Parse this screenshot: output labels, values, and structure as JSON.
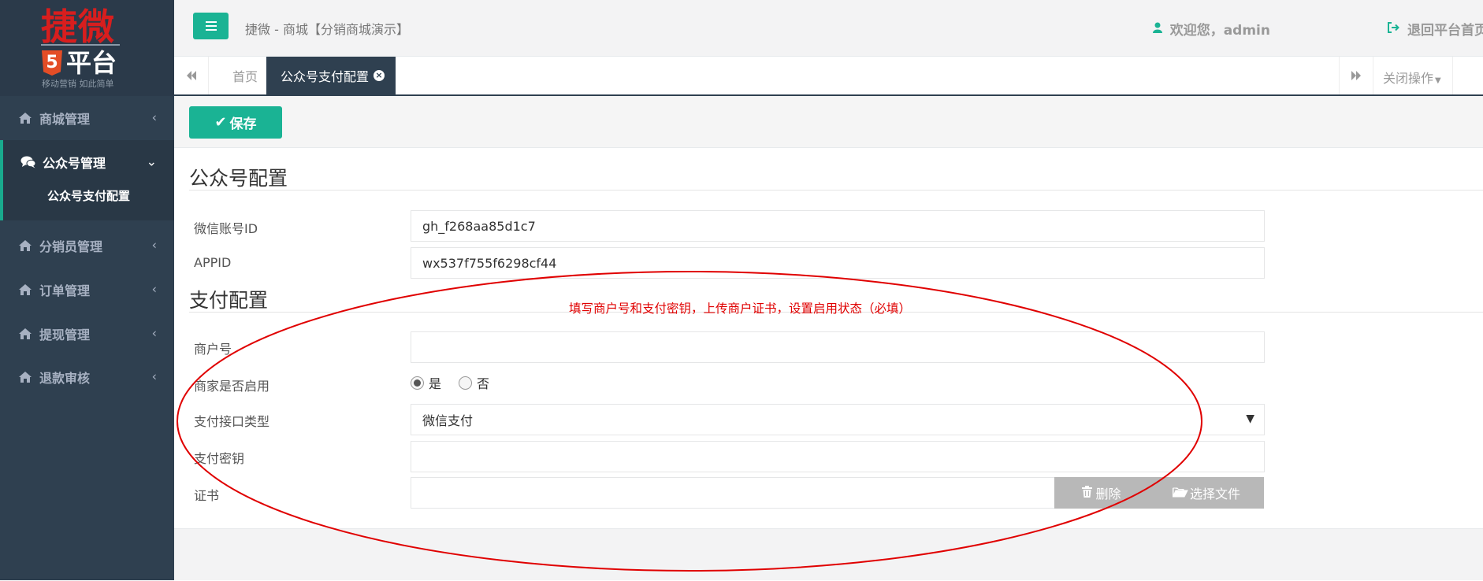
{
  "sidebar": {
    "logo": {
      "brand": "捷微",
      "five": "5",
      "platform": "平台",
      "slogan": "移动营销 如此简单"
    },
    "items": [
      {
        "label": "商城管理",
        "icon": "home-icon",
        "expanded": false
      },
      {
        "label": "公众号管理",
        "icon": "comments-icon",
        "expanded": true,
        "children": [
          {
            "label": "公众号支付配置"
          }
        ]
      },
      {
        "label": "分销员管理",
        "icon": "home-icon",
        "expanded": false
      },
      {
        "label": "订单管理",
        "icon": "home-icon",
        "expanded": false
      },
      {
        "label": "提现管理",
        "icon": "home-icon",
        "expanded": false
      },
      {
        "label": "退款审核",
        "icon": "home-icon",
        "expanded": false
      }
    ],
    "arrow_collapsed": "‹",
    "arrow_expanded": "⌄"
  },
  "header": {
    "title": "捷微 - 商城【分销商城演示】",
    "welcome": "欢迎您，admin",
    "back_home": "退回平台首页"
  },
  "tabs": {
    "home": "首页",
    "active": "公众号支付配置",
    "close_ops": "关闭操作"
  },
  "toolbar": {
    "save_label": "保存"
  },
  "form": {
    "section1_title": "公众号配置",
    "wechat_id_label": "微信账号ID",
    "wechat_id_value": "gh_f268aa85d1c7",
    "appid_label": "APPID",
    "appid_value": "wx537f755f6298cf44",
    "section2_title": "支付配置",
    "merchant_no_label": "商户号",
    "merchant_no_value": "",
    "enabled_label": "商家是否启用",
    "enabled_yes": "是",
    "enabled_no": "否",
    "enabled_selected": "是",
    "pay_type_label": "支付接口类型",
    "pay_type_value": "微信支付",
    "pay_key_label": "支付密钥",
    "pay_key_value": "",
    "cert_label": "证书",
    "cert_value": "",
    "delete_label": "删除",
    "choose_file_label": "选择文件"
  },
  "annotation": {
    "text": "填写商户号和支付密钥，上传商户证书，设置启用状态（必填）",
    "color": "#e00000"
  },
  "colors": {
    "accent": "#1ab394",
    "sidebar": "#2f4050",
    "annotation": "#e00000"
  }
}
